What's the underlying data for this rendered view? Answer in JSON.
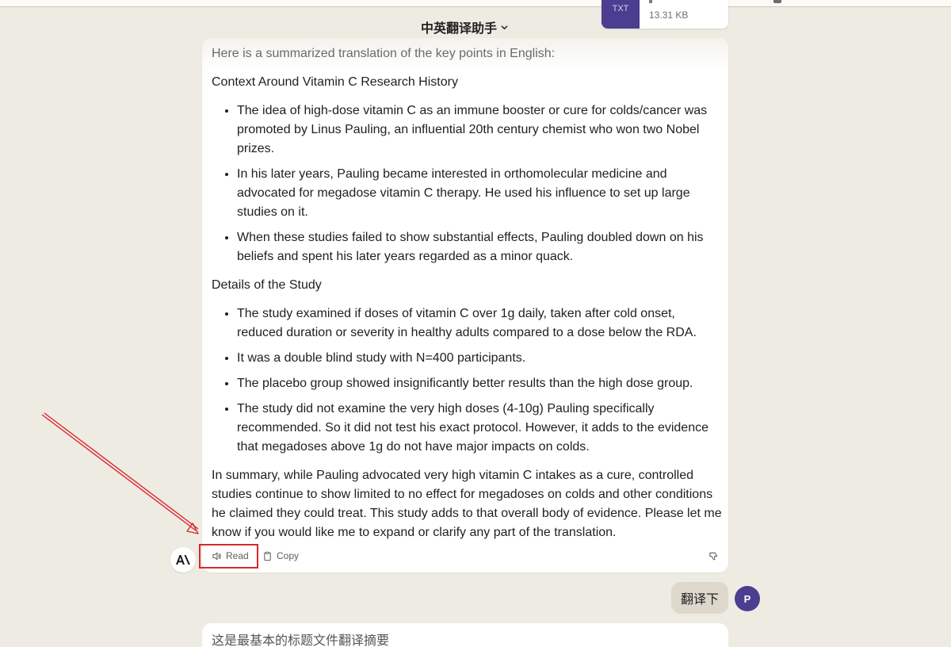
{
  "chat": {
    "title": "中英翻译助手"
  },
  "attachment": {
    "type": "TXT",
    "size": "13.31 KB"
  },
  "message": {
    "intro": "Here is a summarized translation of the key points in English:",
    "section1_heading": "Context Around Vitamin C Research History",
    "section1_items": [
      "The idea of high-dose vitamin C as an immune booster or cure for colds/cancer was promoted by Linus Pauling, an influential 20th century chemist who won two Nobel prizes.",
      "In his later years, Pauling became interested in orthomolecular medicine and advocated for megadose vitamin C therapy. He used his influence to set up large studies on it.",
      "When these studies failed to show substantial effects, Pauling doubled down on his beliefs and spent his later years regarded as a minor quack."
    ],
    "section2_heading": "Details of the Study",
    "section2_items": [
      "The study examined if doses of vitamin C over 1g daily, taken after cold onset, reduced duration or severity in healthy adults compared to a dose below the RDA.",
      "It was a double blind study with N=400 participants.",
      "The placebo group showed insignificantly better results than the high dose group.",
      "The study did not examine the very high doses (4-10g) Pauling specifically recommended. So it did not test his exact protocol. However, it adds to the evidence that megadoses above 1g do not have major impacts on colds."
    ],
    "summary": "In summary, while Pauling advocated very high vitamin C intakes as a cure, controlled studies continue to show limited to no effect for megadoses on colds and other conditions he claimed they could treat. This study adds to that overall body of evidence. Please let me know if you would like me to expand or clarify any part of the translation."
  },
  "actions": {
    "read_label": "Read",
    "copy_label": "Copy"
  },
  "user_message": {
    "text": "翻译下",
    "avatar_initial": "P"
  },
  "next_message": {
    "preview": "这是最基本的标题文件翻译摘要"
  },
  "colors": {
    "background": "#eeebe3",
    "accent_purple": "#4b3d8f",
    "highlight_red": "#d9272e",
    "user_bubble": "#ddd8cb"
  }
}
